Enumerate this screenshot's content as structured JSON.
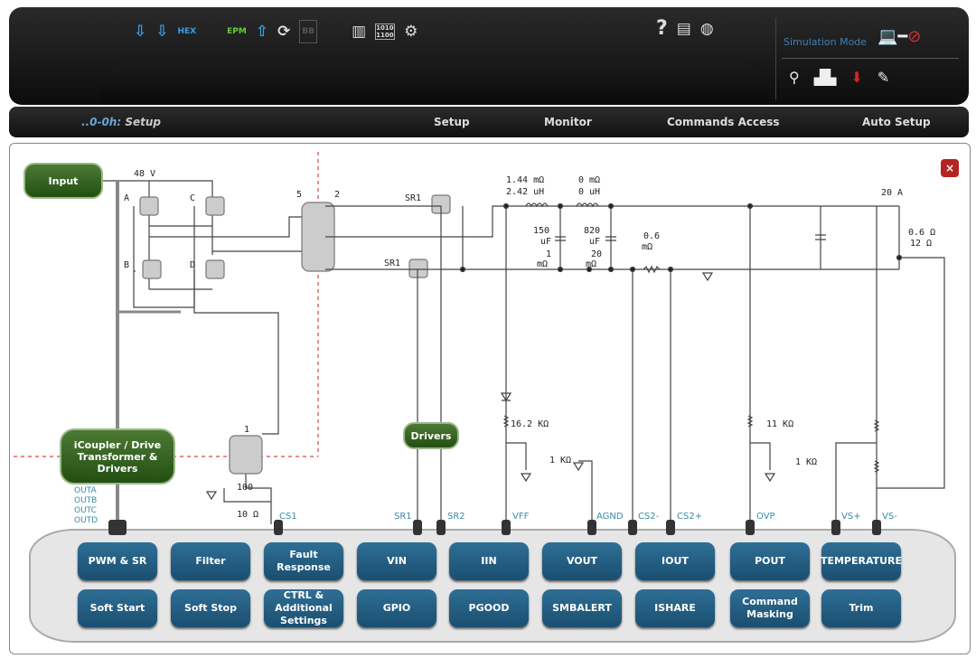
{
  "toolbar": {
    "icons": [
      "upload-icon",
      "download-icon",
      "hex-icon",
      "epm-icon",
      "stack-upload-icon",
      "refresh-icon",
      "bb-icon",
      "grid-icon",
      "binary-icon",
      "gear-icon",
      "help-icon",
      "document-icon",
      "globe-icon"
    ],
    "hex_label": "HEX",
    "epm_label": "EPM",
    "bb_label": "BB",
    "binary_label": "1010 1100",
    "help": "?"
  },
  "sim": {
    "label": "Simulation Mode",
    "tools": [
      "search-icon",
      "peak-icon",
      "import-icon",
      "pencil-icon"
    ]
  },
  "nav": {
    "crumb_prefix": "..0-0h:",
    "crumb": "Setup",
    "tabs": [
      "Setup",
      "Monitor",
      "Commands Access",
      "Auto Setup"
    ]
  },
  "schematic": {
    "input": "Input",
    "v48": "48 V",
    "A": "A",
    "B": "B",
    "C": "C",
    "D": "D",
    "t5": "5",
    "t2": "2",
    "sr1a": "SR1",
    "sr1b": "SR1",
    "l1r": "1.44 mΩ",
    "l1l": "2.42 uH",
    "l2r": "0 mΩ",
    "l2l": "0 uH",
    "c1": "150",
    "c1u": "uF",
    "r1": "1",
    "r1u": "mΩ",
    "c2": "820",
    "c2u": "uF",
    "r2": "20",
    "r2u": "mΩ",
    "rs": "0.6",
    "rsu": "mΩ",
    "iout": "20 A",
    "rl1": "0.6  Ω",
    "rl2": "12  Ω",
    "r16": "16.2 KΩ",
    "r1k": "1 KΩ",
    "r11": "11 KΩ",
    "r1k2": "1 KΩ",
    "ct": "1",
    "r100": "100",
    "r10": "10 Ω",
    "icoupler": "iCoupler / Drive Transformer & Drivers",
    "drivers": "Drivers",
    "outs": [
      "OUTA",
      "OUTB",
      "OUTC",
      "OUTD"
    ],
    "pins": [
      "CS1",
      "SR1",
      "SR2",
      "VFF",
      "AGND",
      "CS2-",
      "CS2+",
      "OVP",
      "VS+",
      "VS-"
    ],
    "close": "×"
  },
  "buttons": [
    [
      "PWM & SR",
      "Filter",
      "Fault Response",
      "VIN",
      "IIN",
      "VOUT",
      "IOUT",
      "POUT",
      "TEMPERATURE"
    ],
    [
      "Soft Start",
      "Soft Stop",
      "CTRL & Additional Settings",
      "GPIO",
      "PGOOD",
      "SMBALERT",
      "ISHARE",
      "Command Masking",
      "Trim"
    ]
  ]
}
